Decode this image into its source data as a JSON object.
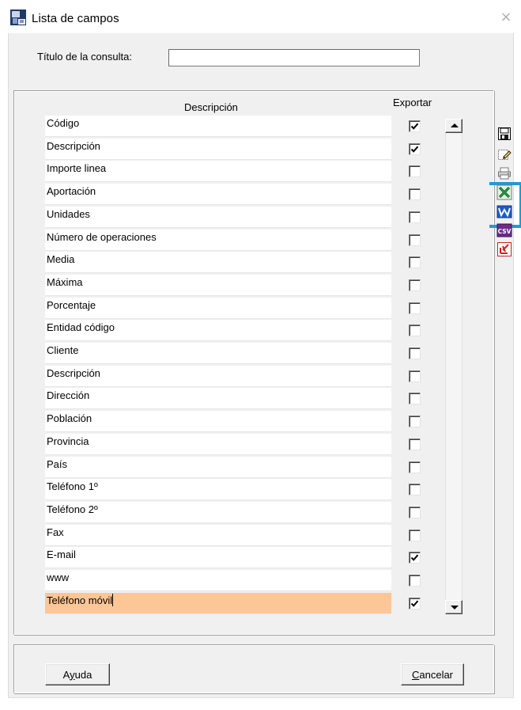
{
  "window": {
    "title": "Lista de campos",
    "close_glyph": "×"
  },
  "query": {
    "label": "Título de la consulta:",
    "value": ""
  },
  "columns": {
    "description": "Descripción",
    "export": "Exportar"
  },
  "fields": [
    {
      "label": "Código",
      "export": true
    },
    {
      "label": "Descripción",
      "export": true
    },
    {
      "label": "Importe linea",
      "export": false
    },
    {
      "label": "Aportación",
      "export": false
    },
    {
      "label": "Unidades",
      "export": false
    },
    {
      "label": "Número de operaciones",
      "export": false
    },
    {
      "label": "Media",
      "export": false
    },
    {
      "label": "Máxima",
      "export": false
    },
    {
      "label": "Porcentaje",
      "export": false
    },
    {
      "label": "Entidad código",
      "export": false
    },
    {
      "label": "Cliente",
      "export": false
    },
    {
      "label": "Descripción",
      "export": false
    },
    {
      "label": "Dirección",
      "export": false
    },
    {
      "label": "Población",
      "export": false
    },
    {
      "label": "Provincia",
      "export": false
    },
    {
      "label": "País",
      "export": false
    },
    {
      "label": "Teléfono 1º",
      "export": false
    },
    {
      "label": "Teléfono 2º",
      "export": false
    },
    {
      "label": "Fax",
      "export": false
    },
    {
      "label": "E-mail",
      "export": true
    },
    {
      "label": "www",
      "export": false
    },
    {
      "label": "Teléfono móvil",
      "export": true,
      "selected": true
    }
  ],
  "toolbar": [
    {
      "icon": "save-icon"
    },
    {
      "icon": "edit-icon"
    },
    {
      "icon": "print-icon"
    },
    {
      "icon": "excel-icon",
      "highlighted": true
    },
    {
      "icon": "word-icon"
    },
    {
      "icon": "csv-icon",
      "text": "CSV"
    },
    {
      "icon": "pdf-icon"
    }
  ],
  "buttons": {
    "help_pre": "A",
    "help_mn": "y",
    "help_post": "uda",
    "cancel_mn": "C",
    "cancel_post": "ancelar"
  },
  "colors": {
    "selected_row": "#fdc696",
    "highlight": "#1d9bd7"
  }
}
